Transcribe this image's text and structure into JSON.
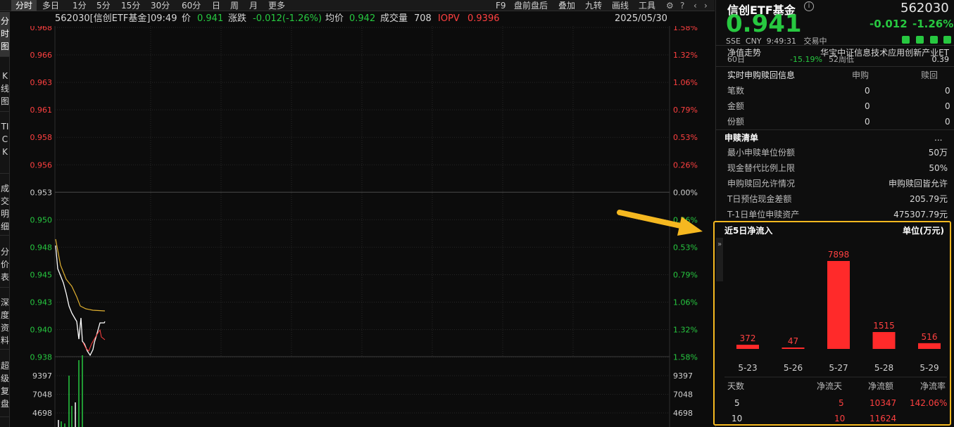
{
  "toolbar": {
    "tabs": [
      "分时",
      "多日",
      "1分",
      "5分",
      "15分",
      "30分",
      "60分",
      "日",
      "周",
      "月",
      "更多"
    ],
    "right": [
      "F9",
      "盘前盘后",
      "叠加",
      "九转",
      "画线",
      "工具"
    ]
  },
  "sidebar": {
    "tabs": [
      "分时图",
      "K线图",
      "TICK",
      "成交明细",
      "分价表",
      "深度资料",
      "超级复盘"
    ]
  },
  "quote_line": {
    "name": "562030[信创ETF基金]",
    "time": "09:49",
    "price_label": "价",
    "price": "0.941",
    "change_label": "涨跌",
    "change": "-0.012(-1.26%)",
    "avg_label": "均价",
    "avg": "0.942",
    "vol_label": "成交量",
    "vol": "708",
    "iopv_label": "IOPV",
    "iopv": "0.9396",
    "date": "2025/05/30"
  },
  "price_axis": {
    "left": [
      "0.968",
      "0.966",
      "0.963",
      "0.961",
      "0.958",
      "0.956",
      "0.953",
      "0.950",
      "0.948",
      "0.945",
      "0.943",
      "0.940",
      "0.938"
    ],
    "right": [
      "1.58%",
      "1.32%",
      "1.06%",
      "0.79%",
      "0.53%",
      "0.26%",
      "0.00%",
      "0.26%",
      "0.53%",
      "0.79%",
      "1.06%",
      "1.32%",
      "1.58%"
    ]
  },
  "volume_axis": {
    "left": [
      "9397",
      "7048",
      "4698"
    ],
    "right": [
      "9397",
      "7048",
      "4698"
    ]
  },
  "header": {
    "name": "信创ETF基金",
    "code": "562030",
    "price": "0.941",
    "change": "-0.012",
    "change_pct": "-1.26%",
    "exchange": "SSE",
    "currency": "CNY",
    "time": "9:49:31",
    "status": "交易中"
  },
  "nav_row": {
    "label": "净值走势",
    "index": "华宝中证信息技术应用创新产业ET"
  },
  "partial_row": {
    "a": "60日",
    "b": "-15.19%",
    "c": "52周低",
    "d": "0.39"
  },
  "realtime": {
    "title": "实时申购赎回信息",
    "col1": "申购",
    "col2": "赎回",
    "rows": [
      {
        "label": "笔数",
        "a": "0",
        "b": "0"
      },
      {
        "label": "金额",
        "a": "0",
        "b": "0"
      },
      {
        "label": "份额",
        "a": "0",
        "b": "0"
      }
    ]
  },
  "creation": {
    "title": "申赎清单",
    "more": "...",
    "rows": [
      {
        "label": "最小申赎单位份额",
        "value": "50万"
      },
      {
        "label": "现金替代比例上限",
        "value": "50%"
      },
      {
        "label": "申购赎回允许情况",
        "value": "申购赎回皆允许"
      },
      {
        "label": "T日预估现金差额",
        "value": "205.79元"
      },
      {
        "label": "T-1日单位申赎资产",
        "value": "475307.79元"
      }
    ]
  },
  "flow": {
    "title": "近5日净流入",
    "unit": "单位(万元)",
    "table_headers": [
      "天数",
      "净流天",
      "净流额",
      "净流率"
    ],
    "table_rows": [
      {
        "days": "5",
        "net_days": "5",
        "net_amount": "10347",
        "net_rate": "142.06%"
      },
      {
        "days": "10",
        "net_days": "10",
        "net_amount": "11624",
        "net_rate": ""
      }
    ]
  },
  "chart_data": {
    "type": "bar",
    "title": "近5日净流入",
    "ylabel": "单位(万元)",
    "categories": [
      "5-23",
      "5-26",
      "5-27",
      "5-28",
      "5-29"
    ],
    "values": [
      372,
      47,
      7898,
      1515,
      516
    ],
    "color": "#ff2a2a"
  },
  "colors": {
    "up": "#ff4040",
    "down": "#27c840",
    "highlight": "#f5b820",
    "avg_line": "#e0b030"
  }
}
